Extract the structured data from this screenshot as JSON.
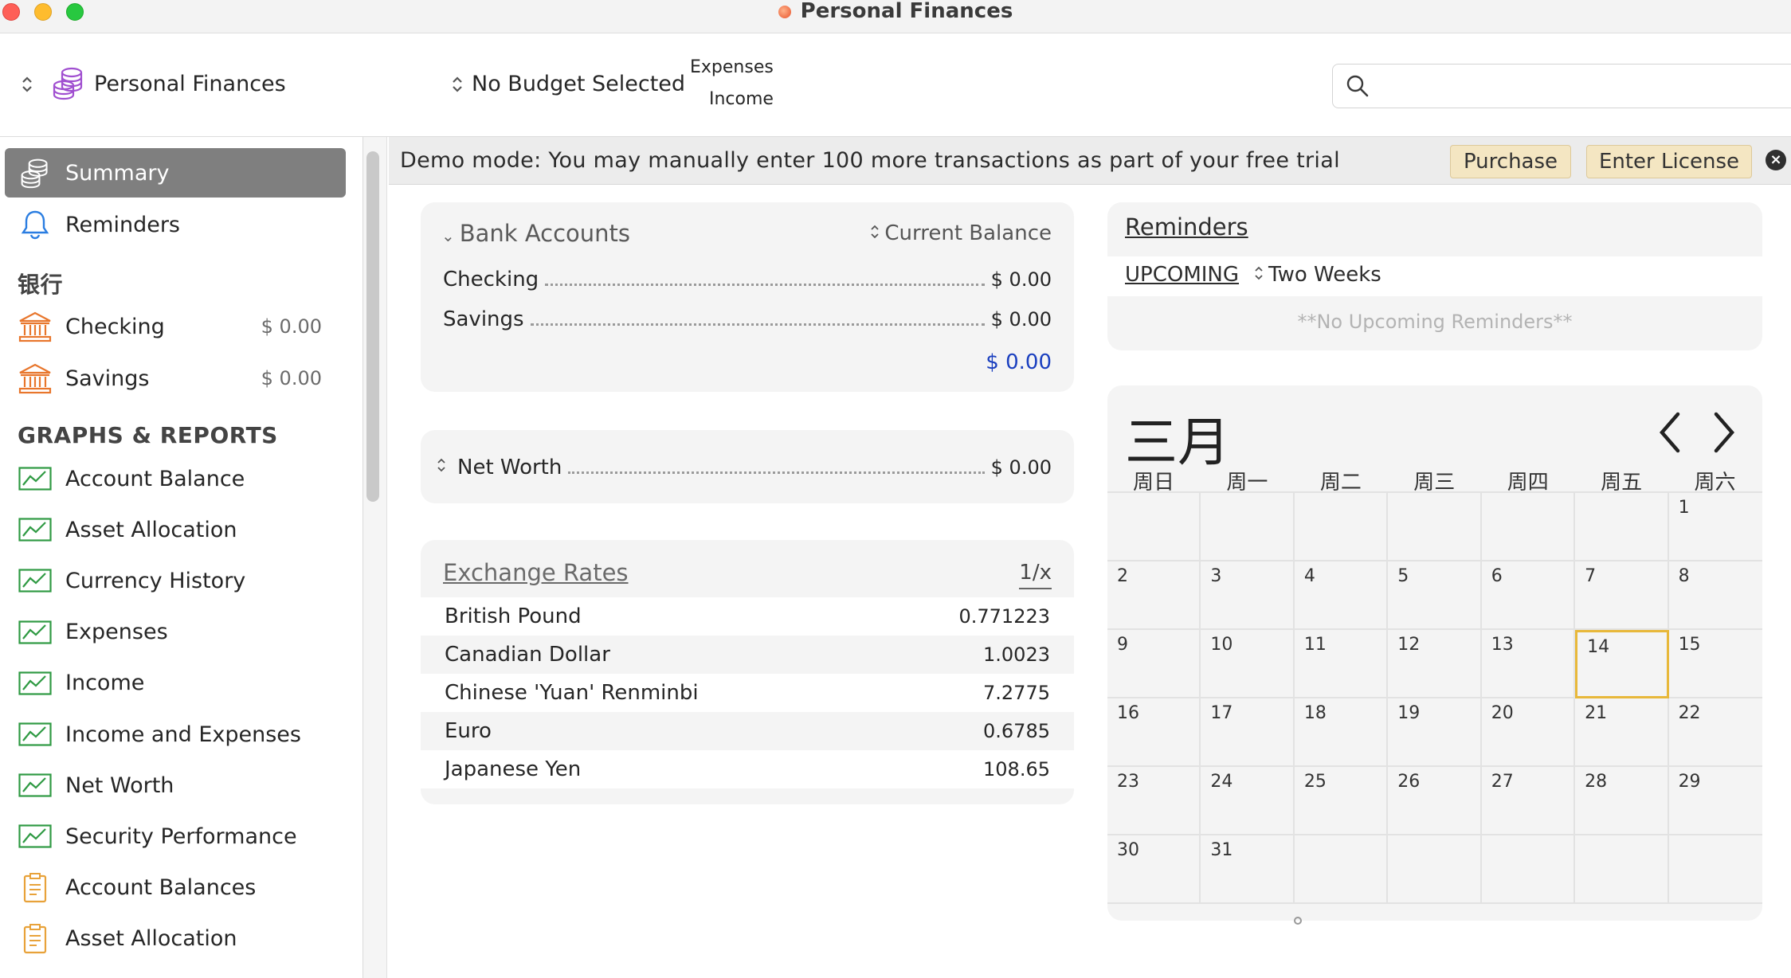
{
  "window": {
    "title": "Personal Finances"
  },
  "toolbar": {
    "file_name": "Personal Finances",
    "budget_label": "No Budget Selected",
    "expenses_label": "Expenses",
    "income_label": "Income",
    "search_placeholder": ""
  },
  "sidebar": {
    "summary": "Summary",
    "reminders": "Reminders",
    "bank_header": "银行",
    "accounts": [
      {
        "label": "Checking",
        "amount": "$ 0.00"
      },
      {
        "label": "Savings",
        "amount": "$ 0.00"
      }
    ],
    "graphs_header": "GRAPHS & REPORTS",
    "graphs": [
      "Account Balance",
      "Asset Allocation",
      "Currency History",
      "Expenses",
      "Income",
      "Income and Expenses",
      "Net Worth",
      "Security Performance"
    ],
    "reports": [
      "Account Balances",
      "Asset Allocation"
    ]
  },
  "demo": {
    "message": "Demo mode:  You may manually enter 100 more transactions as part of your free trial",
    "purchase": "Purchase",
    "enter_license": "Enter License"
  },
  "bank_accounts": {
    "title": "Bank Accounts",
    "column": "Current Balance",
    "rows": [
      {
        "label": "Checking",
        "value": "$ 0.00"
      },
      {
        "label": "Savings",
        "value": "$ 0.00"
      }
    ],
    "total": "$ 0.00"
  },
  "net_worth": {
    "label": "Net Worth",
    "value": "$ 0.00"
  },
  "exchange_rates": {
    "title": "Exchange Rates",
    "toggle": "1/x",
    "rows": [
      {
        "label": "British Pound",
        "value": "0.771223"
      },
      {
        "label": "Canadian Dollar",
        "value": "1.0023"
      },
      {
        "label": "Chinese 'Yuan' Renminbi",
        "value": "7.2775"
      },
      {
        "label": "Euro",
        "value": "0.6785"
      },
      {
        "label": "Japanese Yen",
        "value": "108.65"
      }
    ]
  },
  "reminders": {
    "title": "Reminders",
    "tab": "UPCOMING",
    "range": "Two Weeks",
    "empty": "**No Upcoming Reminders**"
  },
  "calendar": {
    "month": "三月",
    "weekdays": [
      "周日",
      "周一",
      "周二",
      "周三",
      "周四",
      "周五",
      "周六"
    ],
    "weeks": [
      [
        "",
        "",
        "",
        "",
        "",
        "",
        "1"
      ],
      [
        "2",
        "3",
        "4",
        "5",
        "6",
        "7",
        "8"
      ],
      [
        "9",
        "10",
        "11",
        "12",
        "13",
        "14",
        "15"
      ],
      [
        "16",
        "17",
        "18",
        "19",
        "20",
        "21",
        "22"
      ],
      [
        "23",
        "24",
        "25",
        "26",
        "27",
        "28",
        "29"
      ],
      [
        "30",
        "31",
        "",
        "",
        "",
        "",
        ""
      ]
    ],
    "today": "14"
  },
  "colors": {
    "accent_total": "#1a3fbf",
    "bank_icon": "#e8762c",
    "graph_icon": "#2f9a43",
    "report_icon": "#e8a23a",
    "reminder_icon": "#2a7de1",
    "coins_icon": "#a04fd0"
  }
}
